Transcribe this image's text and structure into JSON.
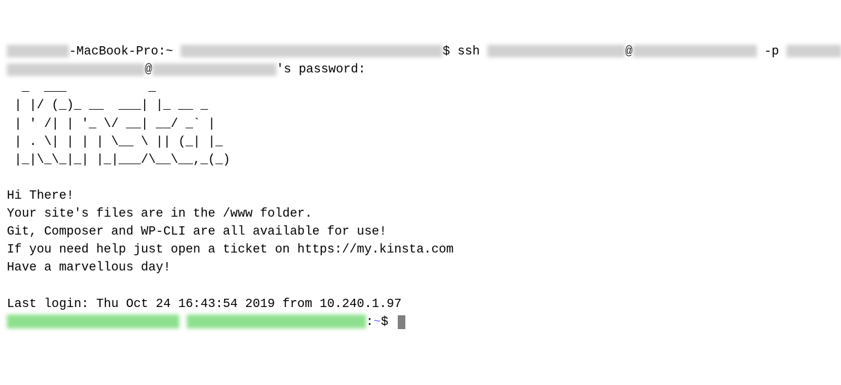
{
  "line1": {
    "host_suffix": "-MacBook-Pro:~ ",
    "prompt_end": "$ ssh ",
    "at": "@",
    "p_flag": " -p "
  },
  "line2": {
    "at": "@",
    "password_label": "'s password:"
  },
  "ascii_art": [
    "  _  ___           _",
    " | |/ (_)_ __  ___| |_ __ _",
    " | ' /| | '_ \\/ __| __/ _` |",
    " | . \\| | | | \\__ \\ || (_| |_",
    " |_|\\_\\_|_| |_|___/\\__\\__,_(_)"
  ],
  "welcome": {
    "greeting": "Hi There!",
    "files_info": "Your site's files are in the /www folder.",
    "tools_info": "Git, Composer and WP-CLI are all available for use!",
    "help_info": "If you need help just open a ticket on https://my.kinsta.com",
    "closing": "Have a marvellous day!"
  },
  "last_login": "Last login: Thu Oct 24 16:43:54 2019 from 10.240.1.97",
  "prompt_tail": {
    "colon": ":",
    "tilde": "~",
    "dollar": "$ "
  }
}
